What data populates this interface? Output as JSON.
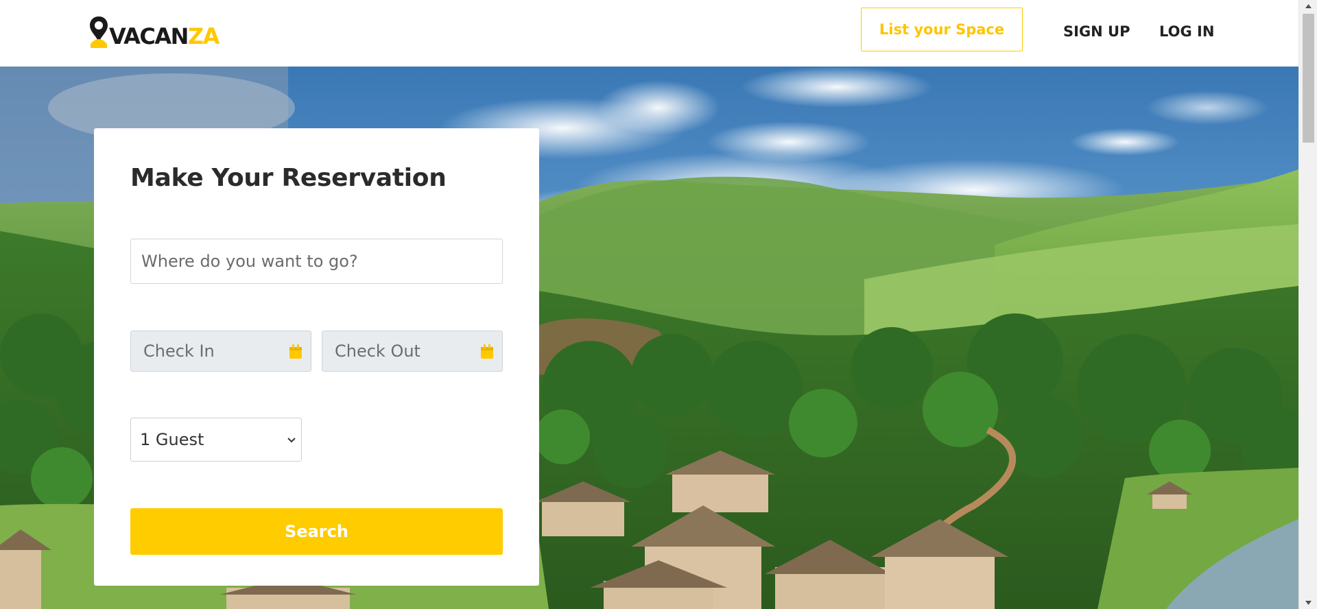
{
  "header": {
    "logo": {
      "text_main": "VACAN",
      "text_accent": "ZA",
      "icon": "location-pin-icon"
    },
    "list_space_label": "List your Space",
    "signup_label": "SIGN UP",
    "login_label": "LOG IN"
  },
  "reservation": {
    "title": "Make Your Reservation",
    "destination_placeholder": "Where do you want to go?",
    "check_in_label": "Check In",
    "check_out_label": "Check Out",
    "calendar_icon": "calendar-icon",
    "guest_selected": "1 Guest",
    "search_label": "Search"
  },
  "colors": {
    "accent": "#ffcc00",
    "text_dark": "#2b2b2b",
    "date_bg": "#e9ecef"
  }
}
